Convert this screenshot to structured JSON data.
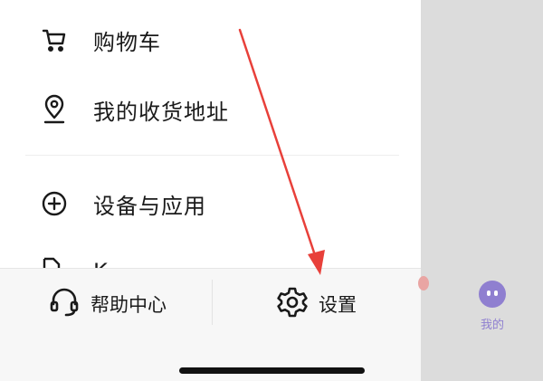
{
  "drawer": {
    "items": [
      {
        "label": "购物车",
        "icon": "shopping-cart-icon"
      },
      {
        "label": "我的收货地址",
        "icon": "location-pin-icon"
      },
      {
        "label": "设备与应用",
        "icon": "plus-circle-icon"
      }
    ],
    "partial_item": {
      "label": "K",
      "icon": "document-icon"
    }
  },
  "bottom_bar": {
    "help": {
      "label": "帮助中心",
      "icon": "headset-icon"
    },
    "settings": {
      "label": "设置",
      "icon": "gear-icon"
    }
  },
  "tab_bar": {
    "mine_label": "我的",
    "mine_icon": "avatar-face-icon",
    "accent": "#8f7fd0"
  },
  "annotation": {
    "arrow_color": "#e8403a"
  }
}
